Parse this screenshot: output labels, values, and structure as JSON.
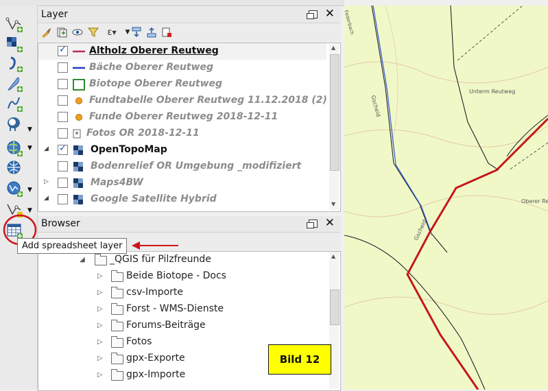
{
  "left_toolbar": {
    "buttons": [
      {
        "name": "add-vector-layer",
        "icon": "vector-layer-icon"
      },
      {
        "name": "add-raster-layer",
        "icon": "raster-layer-icon"
      },
      {
        "name": "add-delimited-text-layer",
        "icon": "comma-layer-icon"
      },
      {
        "name": "add-gpx-layer",
        "icon": "feather-icon"
      },
      {
        "name": "add-spatialite-layer",
        "icon": "spatialite-icon"
      },
      {
        "name": "add-postgis-layer",
        "icon": "elephant-icon"
      },
      {
        "name": "add-wms-layer",
        "icon": "globe-icon"
      },
      {
        "name": "add-wcs-layer",
        "icon": "globe-grid-icon"
      },
      {
        "name": "add-wfs-layer",
        "icon": "wfs-icon"
      },
      {
        "name": "add-virtual-layer",
        "icon": "virtual-layer-icon"
      },
      {
        "name": "add-spreadsheet-layer",
        "icon": "spreadsheet-icon"
      }
    ]
  },
  "layer_panel": {
    "title": "Layer",
    "layers": [
      {
        "name": "Altholz Oberer Reutweg",
        "checked": true,
        "symbol": "line",
        "color": "#b52d57",
        "active": true
      },
      {
        "name": "Bäche Oberer Reutweg",
        "checked": false,
        "symbol": "line",
        "color": "#1f3fbf",
        "active": false
      },
      {
        "name": "Biotope Oberer Reutweg",
        "checked": false,
        "symbol": "polygon",
        "color": "#2e8b2e",
        "active": false
      },
      {
        "name": "Fundtabelle Oberer Reutweg 11.12.2018 (2)",
        "checked": false,
        "symbol": "point",
        "color": "#f0a020",
        "active": false
      },
      {
        "name": "Funde Oberer Reutweg 2018-12-11",
        "checked": false,
        "symbol": "point",
        "color": "#f0a020",
        "active": false
      },
      {
        "name": "Fotos OR 2018-12-11",
        "checked": false,
        "symbol": "photo",
        "color": "#666666",
        "active": false
      },
      {
        "name": "OpenTopoMap",
        "checked": true,
        "symbol": "raster",
        "color": "#1a3a6a",
        "active": true,
        "group": true
      },
      {
        "name": "Bodenrelief OR Umgebung _modifiziert",
        "checked": false,
        "symbol": "raster",
        "color": "#1a3a6a",
        "active": false
      },
      {
        "name": "Maps4BW",
        "checked": false,
        "symbol": "raster",
        "color": "#1a3a6a",
        "active": false,
        "group": true
      },
      {
        "name": "Google Satellite Hybrid",
        "checked": false,
        "symbol": "raster",
        "color": "#1a3a6a",
        "active": false,
        "group": true
      }
    ]
  },
  "browser_panel": {
    "title": "Browser",
    "items": [
      {
        "label": "_QGIS für Pilzfreunde",
        "expanded": true,
        "indent": 0
      },
      {
        "label": "Beide Biotope - Docs",
        "expanded": false,
        "indent": 1
      },
      {
        "label": "csv-Importe",
        "expanded": false,
        "indent": 1
      },
      {
        "label": "Forst - WMS-Dienste",
        "expanded": false,
        "indent": 1
      },
      {
        "label": "Forums-Beiträge",
        "expanded": false,
        "indent": 1
      },
      {
        "label": "Fotos",
        "expanded": false,
        "indent": 1
      },
      {
        "label": "gpx-Exporte",
        "expanded": false,
        "indent": 1
      },
      {
        "label": "gpx-Importe",
        "expanded": false,
        "indent": 1
      }
    ]
  },
  "tooltip": "Add spreadsheet layer",
  "annotation_label": "Bild 12",
  "map": {
    "labels": [
      "Federbach",
      "Gscheid",
      "Unterm Reutweg",
      "Oberer Reutweg",
      "Gscheid"
    ],
    "background": "#f1f8c8",
    "route_color": "#c4181a"
  },
  "colors": {
    "annotation_red": "#d0151a",
    "annotation_yellow": "#ffff00"
  }
}
